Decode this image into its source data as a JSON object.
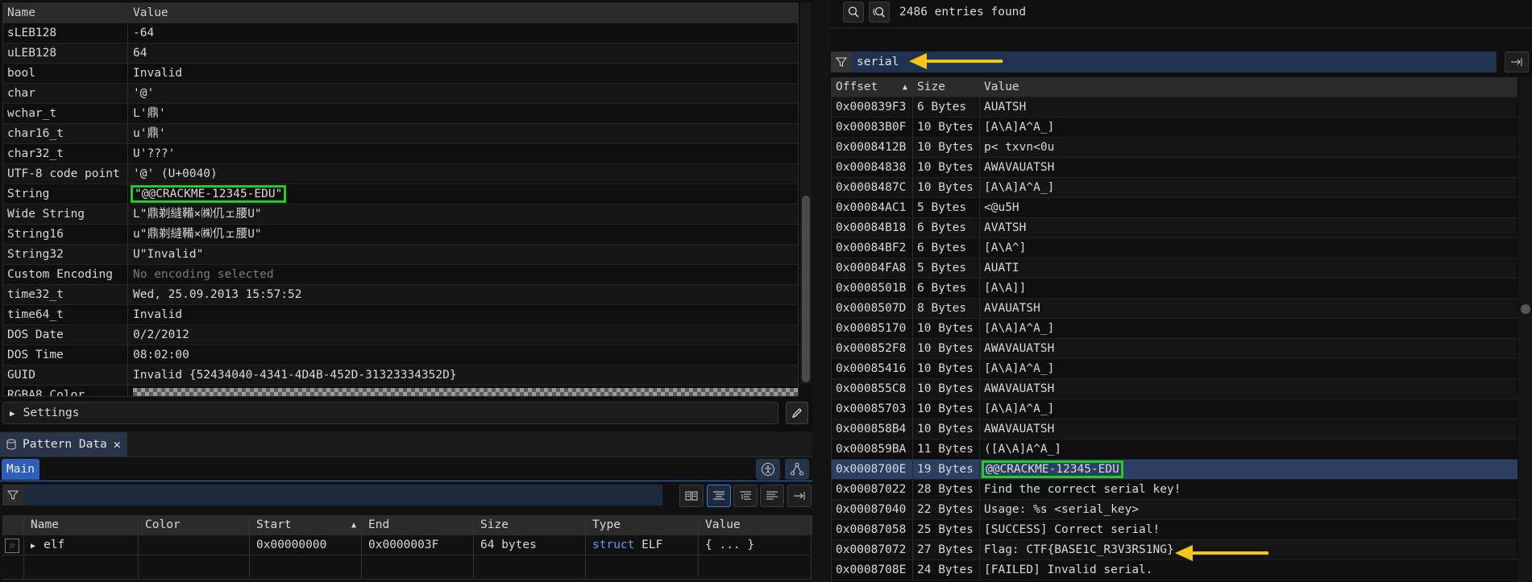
{
  "inspector": {
    "header": {
      "name": "Name",
      "value": "Value"
    },
    "rows": [
      {
        "name": "sLEB128",
        "value": "-64"
      },
      {
        "name": "uLEB128",
        "value": "64"
      },
      {
        "name": "bool",
        "value": "Invalid"
      },
      {
        "name": "char",
        "value": "'@'"
      },
      {
        "name": "wchar_t",
        "value": "L'鼎'"
      },
      {
        "name": "char16_t",
        "value": "u'鼎'"
      },
      {
        "name": "char32_t",
        "value": "U'???'"
      },
      {
        "name": "UTF-8 code point",
        "value": "'@' (U+0040)"
      },
      {
        "name": "String",
        "value": "\"@@CRACKME-12345-EDU\""
      },
      {
        "name": "Wide String",
        "value": "L\"鼎剃縫鞴×㈱仉ェ腰U\""
      },
      {
        "name": "String16",
        "value": "u\"鼎剃縫鞴×㈱仉ェ腰U\""
      },
      {
        "name": "String32",
        "value": "U\"Invalid\""
      },
      {
        "name": "Custom Encoding",
        "value": "No encoding selected"
      },
      {
        "name": "time32_t",
        "value": "Wed, 25.09.2013 15:57:52"
      },
      {
        "name": "time64_t",
        "value": "Invalid"
      },
      {
        "name": "DOS Date",
        "value": "0/2/2012"
      },
      {
        "name": "DOS Time",
        "value": "08:02:00"
      },
      {
        "name": "GUID",
        "value": "Invalid {52434040-4341-4D4B-452D-31323334352D}"
      },
      {
        "name": "RGBA8 Color",
        "value": ""
      }
    ],
    "settings_label": "Settings"
  },
  "pattern": {
    "tab_title": "Pattern Data",
    "main_tab": "Main",
    "columns": [
      "",
      "Name",
      "Color",
      "Start",
      "End",
      "Size",
      "Type",
      "Value"
    ],
    "rows": [
      {
        "name": "elf",
        "color": "",
        "start": "0x00000000",
        "end": "0x0000003F",
        "size": "64 bytes",
        "type_kw": "struct",
        "type_name": "ELF",
        "value": "{ ... }"
      }
    ]
  },
  "strings": {
    "entries_found": "2486 entries found",
    "filter": "serial",
    "columns": {
      "offset": "Offset",
      "size": "Size",
      "value": "Value"
    },
    "rows": [
      {
        "offset": "0x000839F3",
        "size": "6 Bytes",
        "value": "AUATSH"
      },
      {
        "offset": "0x00083B0F",
        "size": "10 Bytes",
        "value": "[A\\A]A^A_]"
      },
      {
        "offset": "0x0008412B",
        "size": "10 Bytes",
        "value": "p< txvn<0u"
      },
      {
        "offset": "0x00084838",
        "size": "10 Bytes",
        "value": "AWAVAUATSH"
      },
      {
        "offset": "0x0008487C",
        "size": "10 Bytes",
        "value": "[A\\A]A^A_]"
      },
      {
        "offset": "0x00084AC1",
        "size": "5 Bytes",
        "value": "<@u5H"
      },
      {
        "offset": "0x00084B18",
        "size": "6 Bytes",
        "value": "AVATSH"
      },
      {
        "offset": "0x00084BF2",
        "size": "6 Bytes",
        "value": "[A\\A^]"
      },
      {
        "offset": "0x00084FA8",
        "size": "5 Bytes",
        "value": "AUATI"
      },
      {
        "offset": "0x0008501B",
        "size": "6 Bytes",
        "value": "[A\\A]]"
      },
      {
        "offset": "0x0008507D",
        "size": "8 Bytes",
        "value": "AVAUATSH"
      },
      {
        "offset": "0x00085170",
        "size": "10 Bytes",
        "value": "[A\\A]A^A_]"
      },
      {
        "offset": "0x000852F8",
        "size": "10 Bytes",
        "value": "AWAVAUATSH"
      },
      {
        "offset": "0x00085416",
        "size": "10 Bytes",
        "value": "[A\\A]A^A_]"
      },
      {
        "offset": "0x000855C8",
        "size": "10 Bytes",
        "value": "AWAVAUATSH"
      },
      {
        "offset": "0x00085703",
        "size": "10 Bytes",
        "value": "[A\\A]A^A_]"
      },
      {
        "offset": "0x000858B4",
        "size": "10 Bytes",
        "value": "AWAVAUATSH"
      },
      {
        "offset": "0x000859BA",
        "size": "11 Bytes",
        "value": "([A\\A]A^A_]"
      },
      {
        "offset": "0x0008700E",
        "size": "19 Bytes",
        "value": "@@CRACKME-12345-EDU"
      },
      {
        "offset": "0x00087022",
        "size": "28 Bytes",
        "value": "Find the correct serial key!"
      },
      {
        "offset": "0x00087040",
        "size": "22 Bytes",
        "value": "Usage: %s <serial_key>"
      },
      {
        "offset": "0x00087058",
        "size": "25 Bytes",
        "value": "[SUCCESS] Correct serial!"
      },
      {
        "offset": "0x00087072",
        "size": "27 Bytes",
        "value": "Flag: CTF{BASE1C_R3V3RS1NG}"
      },
      {
        "offset": "0x0008708E",
        "size": "24 Bytes",
        "value": "[FAILED] Invalid serial."
      }
    ],
    "selected_index": 18
  },
  "colors": {
    "highlight_green": "#22cc22",
    "arrow_yellow": "#f5c518",
    "selection_blue": "#2a3f62",
    "accent_blue": "#2d5fb8"
  }
}
